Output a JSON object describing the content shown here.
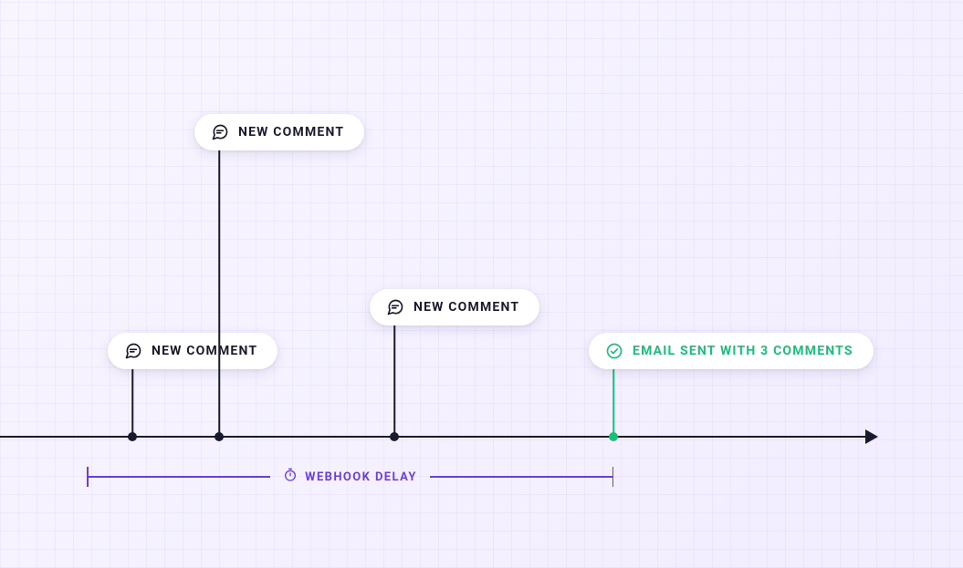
{
  "events": [
    {
      "label": "NEW COMMENT",
      "kind": "comment"
    },
    {
      "label": "NEW COMMENT",
      "kind": "comment"
    },
    {
      "label": "NEW COMMENT",
      "kind": "comment"
    },
    {
      "label": "EMAIL SENT WITH 3 COMMENTS",
      "kind": "sent"
    }
  ],
  "delay_label": "WEBHOOK DELAY",
  "colors": {
    "axis": "#1a1a2e",
    "accent": "#6b3fd9",
    "success": "#18c07a"
  }
}
